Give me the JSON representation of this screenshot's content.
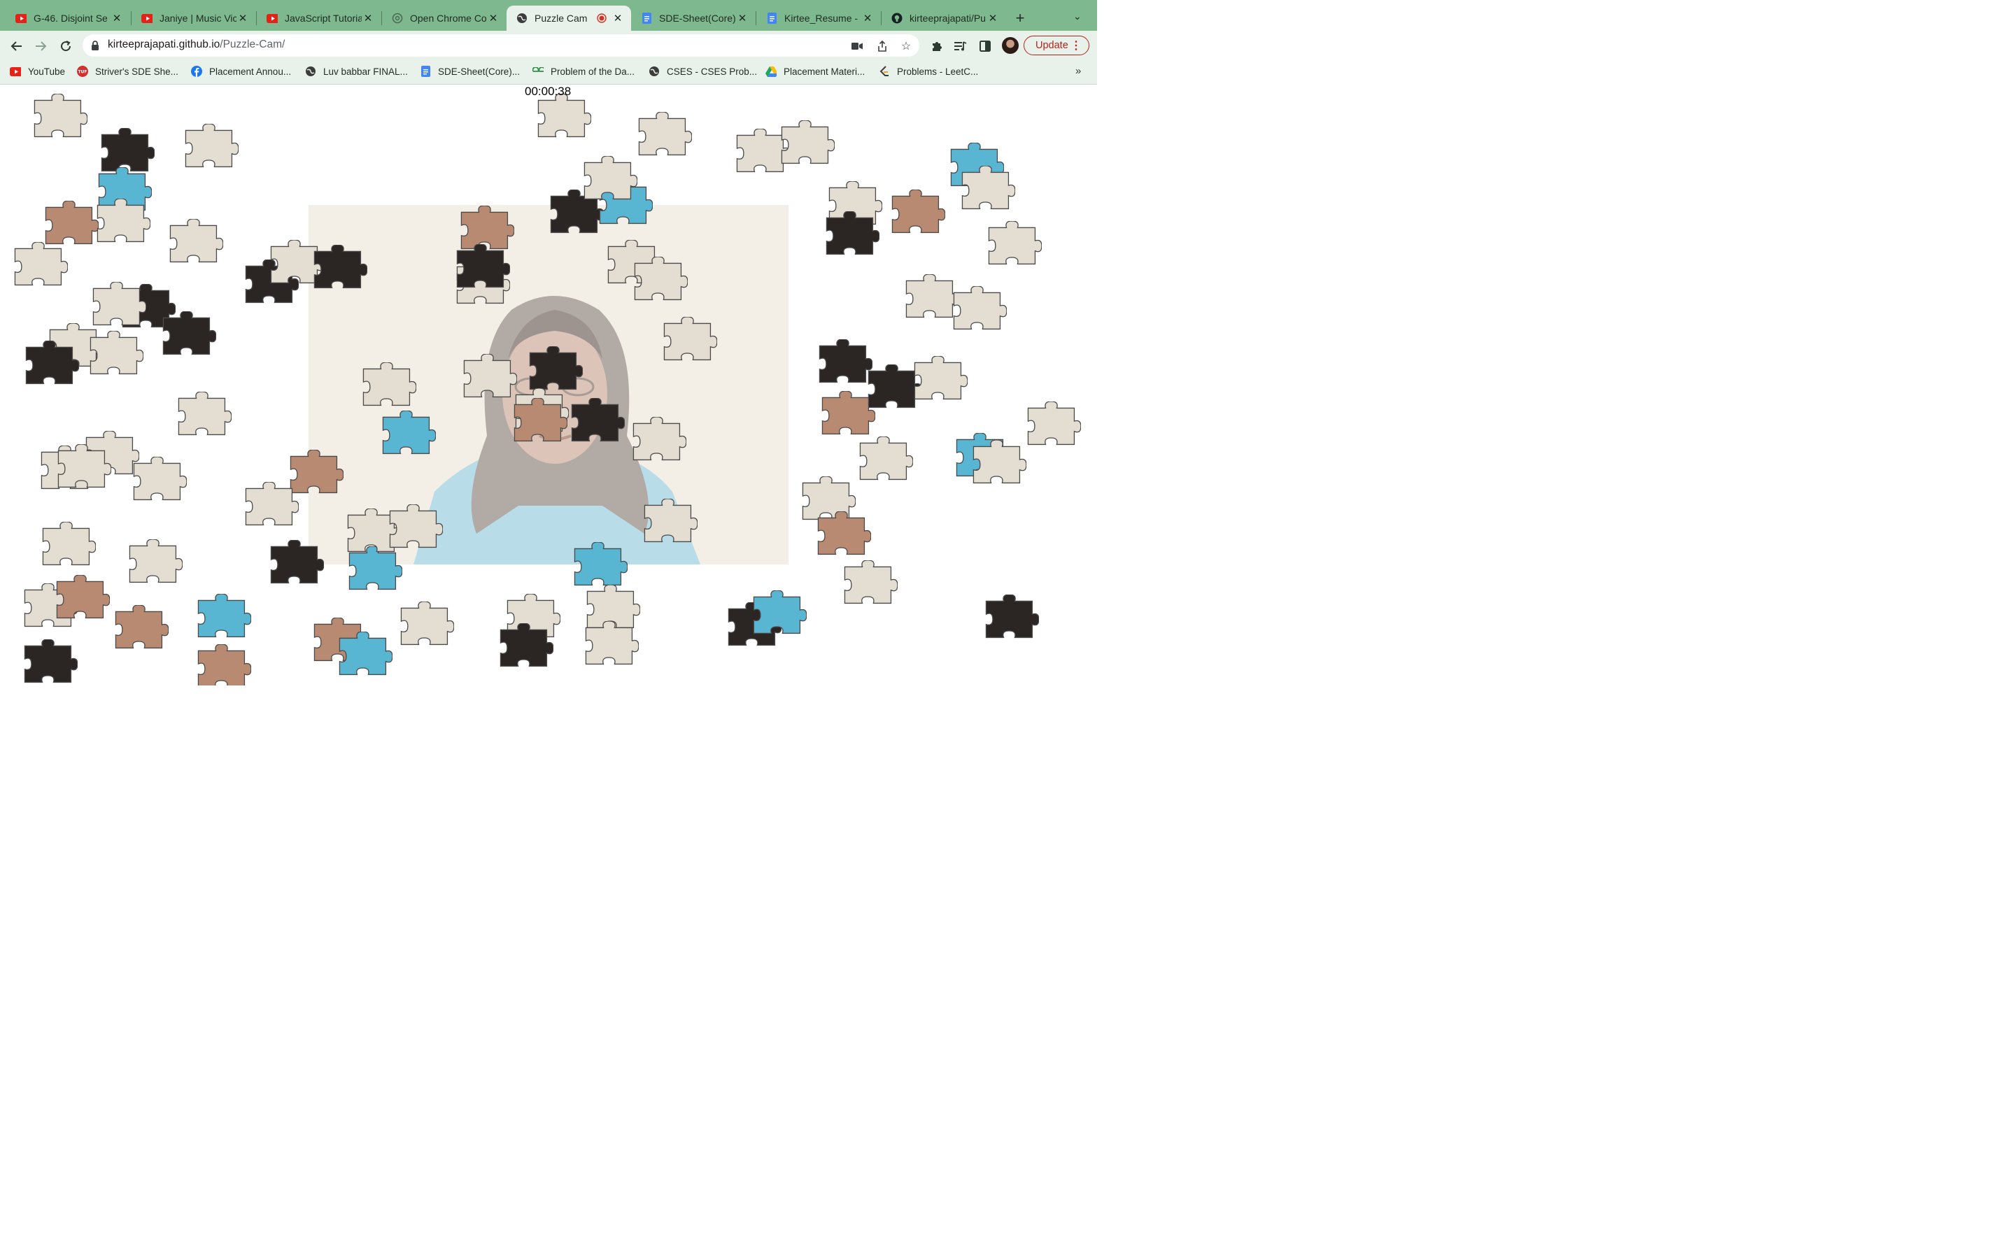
{
  "browser": {
    "tabs": [
      {
        "title": "G-46. Disjoint Se",
        "icon": "youtube-icon",
        "active": false
      },
      {
        "title": "Janiye | Music Vic",
        "icon": "youtube-icon",
        "active": false
      },
      {
        "title": "JavaScript Tutoria",
        "icon": "youtube-icon",
        "active": false
      },
      {
        "title": "Open Chrome Co",
        "icon": "openai-icon",
        "active": false
      },
      {
        "title": "Puzzle Cam",
        "icon": "globe-icon",
        "active": true,
        "recording": true
      },
      {
        "title": "SDE-Sheet(Core)",
        "icon": "docs-icon",
        "active": false
      },
      {
        "title": "Kirtee_Resume -",
        "icon": "docs-icon",
        "active": false
      },
      {
        "title": "kirteeprajapati/Pu",
        "icon": "github-icon",
        "active": false
      }
    ],
    "new_tab": "+",
    "address": {
      "domain": "kirteeprajapati.github.io",
      "path": "/Puzzle-Cam/"
    },
    "update_label": "Update",
    "bookmarks": [
      {
        "label": "YouTube",
        "icon": "youtube-icon"
      },
      {
        "label": "Striver's SDE She...",
        "icon": "tuf-icon"
      },
      {
        "label": "Placement Annou...",
        "icon": "facebook-icon"
      },
      {
        "label": "Luv babbar FINAL...",
        "icon": "globe-icon"
      },
      {
        "label": "SDE-Sheet(Core)...",
        "icon": "docs-icon"
      },
      {
        "label": "Problem of the Da...",
        "icon": "gfg-icon"
      },
      {
        "label": "CSES - CSES Prob...",
        "icon": "globe-icon"
      },
      {
        "label": "Placement Materi...",
        "icon": "drive-icon"
      },
      {
        "label": "Problems - LeetC...",
        "icon": "leetcode-icon"
      }
    ]
  },
  "game": {
    "timer": "00:00:38",
    "colors": {
      "blank": "#e4ddd1",
      "outline": "#4a4a4a",
      "shirt": "#58b6d3",
      "skin": "#b98a72",
      "hair": "#2b2624",
      "background": "#ffffff"
    },
    "pieces": [
      {
        "id": 1,
        "tone": "blank"
      },
      {
        "id": 2,
        "tone": "hair"
      },
      {
        "id": 3,
        "tone": "blank"
      },
      {
        "id": 4,
        "tone": "shirt"
      },
      {
        "id": 5,
        "tone": "skin"
      },
      {
        "id": 6,
        "tone": "blank"
      },
      {
        "id": 7,
        "tone": "blank"
      },
      {
        "id": 8,
        "tone": "hair"
      },
      {
        "id": 9,
        "tone": "blank"
      },
      {
        "id": 10,
        "tone": "blank"
      },
      {
        "id": 11,
        "tone": "hair"
      },
      {
        "id": 12,
        "tone": "blank"
      },
      {
        "id": 13,
        "tone": "blank"
      },
      {
        "id": 14,
        "tone": "hair"
      },
      {
        "id": 15,
        "tone": "blank"
      },
      {
        "id": 16,
        "tone": "blank"
      },
      {
        "id": 17,
        "tone": "blank"
      },
      {
        "id": 18,
        "tone": "blank"
      },
      {
        "id": 19,
        "tone": "blank"
      },
      {
        "id": 20,
        "tone": "blank"
      },
      {
        "id": 21,
        "tone": "blank"
      },
      {
        "id": 22,
        "tone": "skin"
      },
      {
        "id": 23,
        "tone": "shirt"
      },
      {
        "id": 24,
        "tone": "blank"
      },
      {
        "id": 25,
        "tone": "hair"
      },
      {
        "id": 26,
        "tone": "skin"
      },
      {
        "id": 27,
        "tone": "skin"
      },
      {
        "id": 28,
        "tone": "hair"
      },
      {
        "id": 29,
        "tone": "blank"
      },
      {
        "id": 30,
        "tone": "hair"
      },
      {
        "id": 31,
        "tone": "skin"
      },
      {
        "id": 32,
        "tone": "blank"
      },
      {
        "id": 33,
        "tone": "hair"
      },
      {
        "id": 34,
        "tone": "skin"
      },
      {
        "id": 35,
        "tone": "shirt"
      },
      {
        "id": 36,
        "tone": "blank"
      },
      {
        "id": 37,
        "tone": "blank"
      },
      {
        "id": 38,
        "tone": "blank"
      },
      {
        "id": 39,
        "tone": "shirt"
      },
      {
        "id": 40,
        "tone": "shirt"
      },
      {
        "id": 41,
        "tone": "blank"
      },
      {
        "id": 42,
        "tone": "blank"
      },
      {
        "id": 43,
        "tone": "skin"
      },
      {
        "id": 44,
        "tone": "hair"
      },
      {
        "id": 45,
        "tone": "hair"
      },
      {
        "id": 46,
        "tone": "shirt"
      },
      {
        "id": 47,
        "tone": "blank"
      },
      {
        "id": 48,
        "tone": "blank"
      },
      {
        "id": 49,
        "tone": "blank"
      },
      {
        "id": 50,
        "tone": "blank"
      },
      {
        "id": 51,
        "tone": "blank"
      },
      {
        "id": 52,
        "tone": "blank"
      },
      {
        "id": 53,
        "tone": "hair"
      },
      {
        "id": 54,
        "tone": "blank"
      },
      {
        "id": 55,
        "tone": "blank"
      },
      {
        "id": 56,
        "tone": "hair"
      },
      {
        "id": 57,
        "tone": "skin"
      },
      {
        "id": 58,
        "tone": "blank"
      },
      {
        "id": 59,
        "tone": "blank"
      },
      {
        "id": 60,
        "tone": "shirt"
      },
      {
        "id": 61,
        "tone": "blank"
      },
      {
        "id": 62,
        "tone": "blank"
      },
      {
        "id": 63,
        "tone": "hair"
      },
      {
        "id": 64,
        "tone": "blank"
      },
      {
        "id": 65,
        "tone": "blank"
      },
      {
        "id": 66,
        "tone": "blank"
      },
      {
        "id": 67,
        "tone": "shirt"
      },
      {
        "id": 68,
        "tone": "blank"
      },
      {
        "id": 69,
        "tone": "blank"
      },
      {
        "id": 70,
        "tone": "hair"
      },
      {
        "id": 71,
        "tone": "skin"
      },
      {
        "id": 72,
        "tone": "blank"
      },
      {
        "id": 73,
        "tone": "blank"
      },
      {
        "id": 74,
        "tone": "blank"
      },
      {
        "id": 75,
        "tone": "hair"
      },
      {
        "id": 76,
        "tone": "hair"
      },
      {
        "id": 77,
        "tone": "blank"
      },
      {
        "id": 78,
        "tone": "skin"
      },
      {
        "id": 79,
        "tone": "blank"
      },
      {
        "id": 80,
        "tone": "shirt"
      },
      {
        "id": 81,
        "tone": "blank"
      },
      {
        "id": 82,
        "tone": "blank"
      },
      {
        "id": 83,
        "tone": "blank"
      },
      {
        "id": 84,
        "tone": "skin"
      },
      {
        "id": 85,
        "tone": "hair"
      },
      {
        "id": 86,
        "tone": "shirt"
      },
      {
        "id": 87,
        "tone": "blank"
      },
      {
        "id": 88,
        "tone": "hair"
      }
    ]
  }
}
